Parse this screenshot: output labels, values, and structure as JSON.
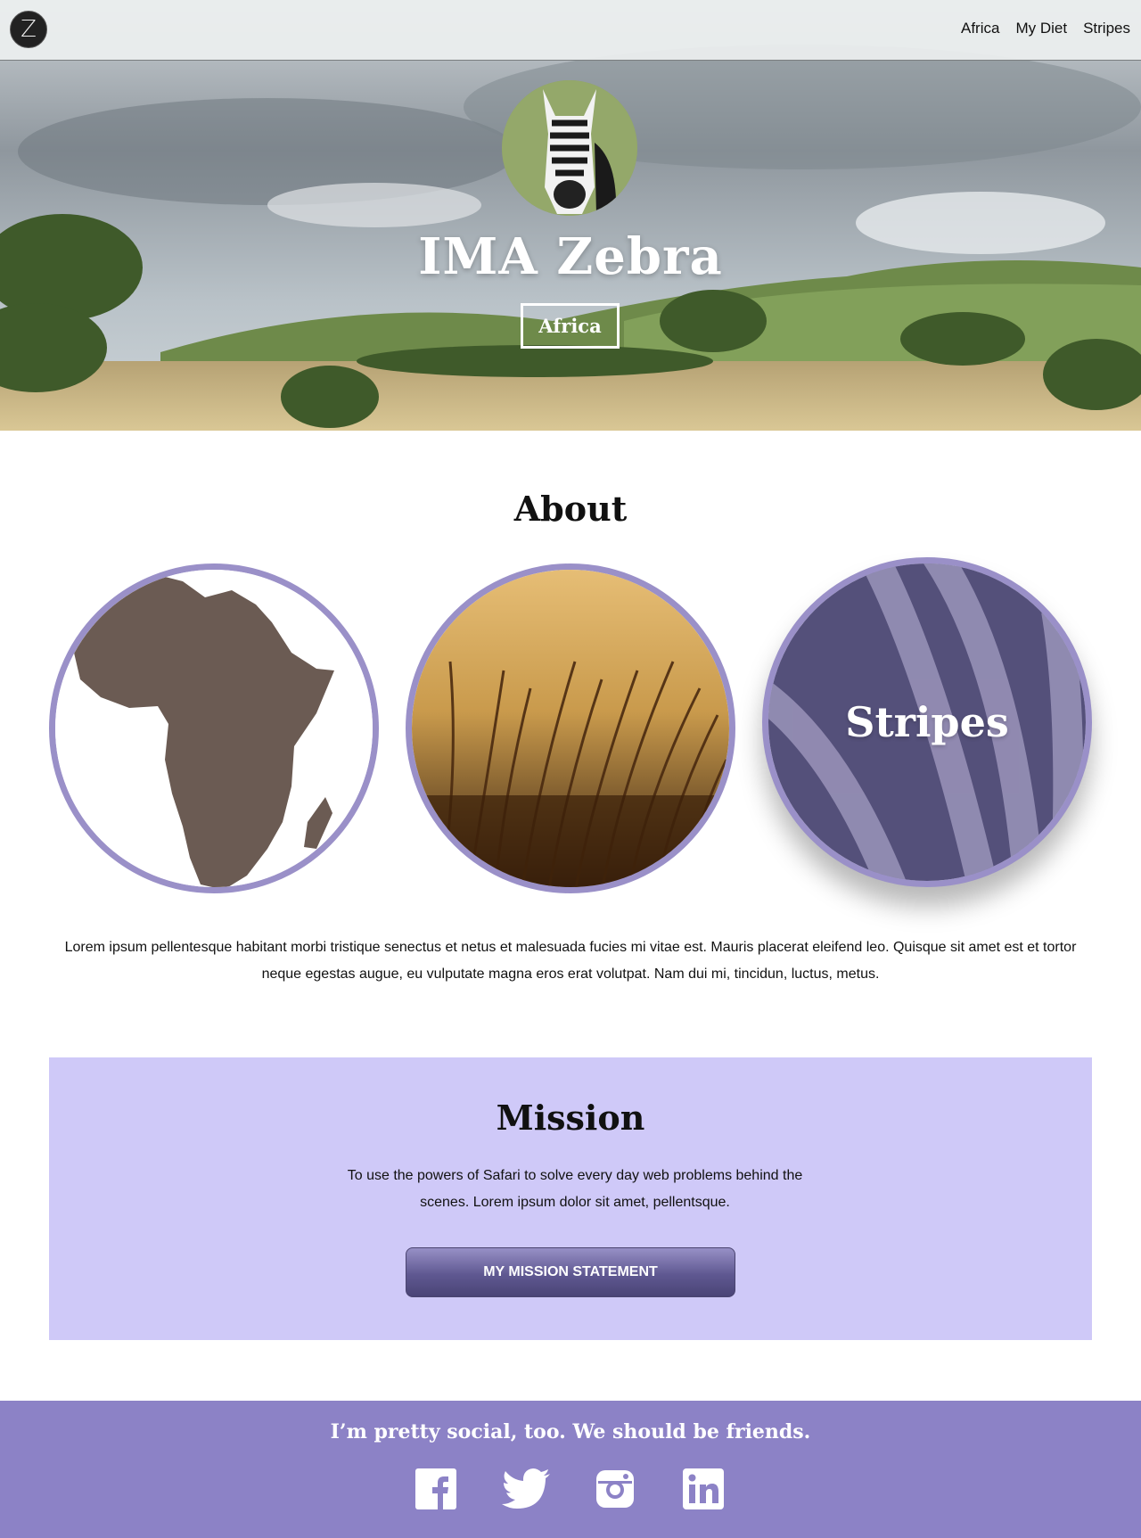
{
  "nav": {
    "logo_letter": "Z",
    "links": [
      "Africa",
      "My Diet",
      "Stripes"
    ]
  },
  "hero": {
    "title": "IMA Zebra",
    "button_label": "Africa"
  },
  "about": {
    "title": "About",
    "cards": [
      {
        "icon": "africa-map-icon"
      },
      {
        "icon": "savanna-grass-image"
      },
      {
        "icon": "zebra-stripes-image",
        "label": "Stripes"
      }
    ],
    "text": "Lorem ipsum pellentesque habitant morbi tristique senectus et netus et malesuada fucies mi vitae est. Mauris placerat eleifend leo. Quisque sit amet est et tortor neque egestas augue, eu vulputate magna eros erat volutpat. Nam dui mi, tincidun, luctus, metus."
  },
  "mission": {
    "title": "Mission",
    "text": "To use the powers of Safari to solve every day web problems behind the scenes. Lorem ipsum dolor sit amet, pellentsque.",
    "button_label": "MY MISSION STATEMENT"
  },
  "footer": {
    "text": "I’m pretty social, too. We should be friends.",
    "socials": [
      "facebook-icon",
      "twitter-icon",
      "instagram-icon",
      "linkedin-icon"
    ]
  },
  "colors": {
    "accent": "#9a90c8",
    "mission_bg": "#cfc9f8",
    "footer_bg": "#8c82c6",
    "africa_fill": "#6b5b53"
  }
}
